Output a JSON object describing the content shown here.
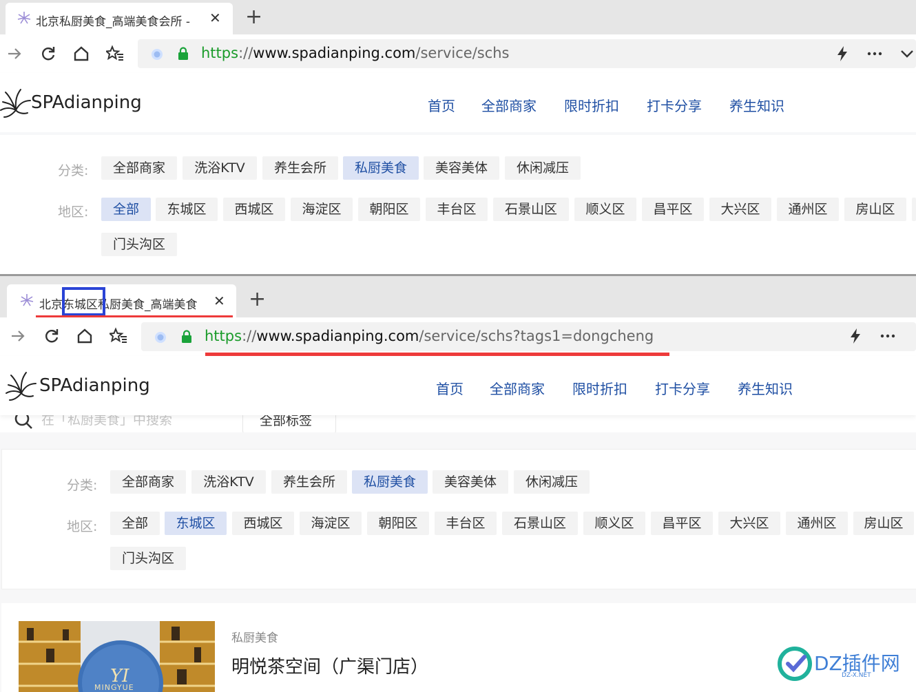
{
  "screen1": {
    "tab_title": "北京私厨美食_高端美食会所 -",
    "url_scheme": "https",
    "url_sep": "://",
    "url_host": "www.spadianping.com",
    "url_path": "/service/schs",
    "logo": "SPAdianping",
    "nav": [
      "首页",
      "全部商家",
      "限时折扣",
      "打卡分享",
      "养生知识"
    ],
    "category_label": "分类:",
    "categories": [
      "全部商家",
      "洗浴KTV",
      "养生会所",
      "私厨美食",
      "美容美体",
      "休闲减压"
    ],
    "active_category": "私厨美食",
    "district_label": "地区:",
    "districts": [
      "全部",
      "东城区",
      "西城区",
      "海淀区",
      "朝阳区",
      "丰台区",
      "石景山区",
      "顺义区",
      "昌平区",
      "大兴区",
      "通州区",
      "房山区",
      "门头沟区"
    ],
    "active_district": "全部"
  },
  "screen2": {
    "tab_title_prefix": "北京",
    "tab_title_highlight": "东城区",
    "tab_title_rest": "私厨美食_高端美食",
    "url_scheme": "https",
    "url_sep": "://",
    "url_host": "www.spadianping.com",
    "url_path": "/service/schs?tags1=dongcheng",
    "logo": "SPAdianping",
    "nav": [
      "首页",
      "全部商家",
      "限时折扣",
      "打卡分享",
      "养生知识"
    ],
    "search_placeholder": "在「私厨美食」中搜索",
    "tag_select": "全部标签",
    "category_label": "分类:",
    "categories": [
      "全部商家",
      "洗浴KTV",
      "养生会所",
      "私厨美食",
      "美容美体",
      "休闲减压"
    ],
    "active_category": "私厨美食",
    "district_label": "地区:",
    "districts": [
      "全部",
      "东城区",
      "西城区",
      "海淀区",
      "朝阳区",
      "丰台区",
      "石景山区",
      "顺义区",
      "昌平区",
      "大兴区",
      "通州区",
      "房山区",
      "门头沟区"
    ],
    "active_district": "东城区",
    "listing": {
      "category": "私厨美食",
      "title": "明悦茶空间（广渠门店）",
      "image_text": "MINGYUE"
    }
  },
  "watermark": {
    "text": "DZ插件网",
    "sub": "DZ-X.NET"
  },
  "colors": {
    "accent": "#1f4fa3",
    "annotation_red": "#ee3a3a",
    "annotation_blue": "#2a44d6",
    "https_green": "#1a9b2a"
  }
}
